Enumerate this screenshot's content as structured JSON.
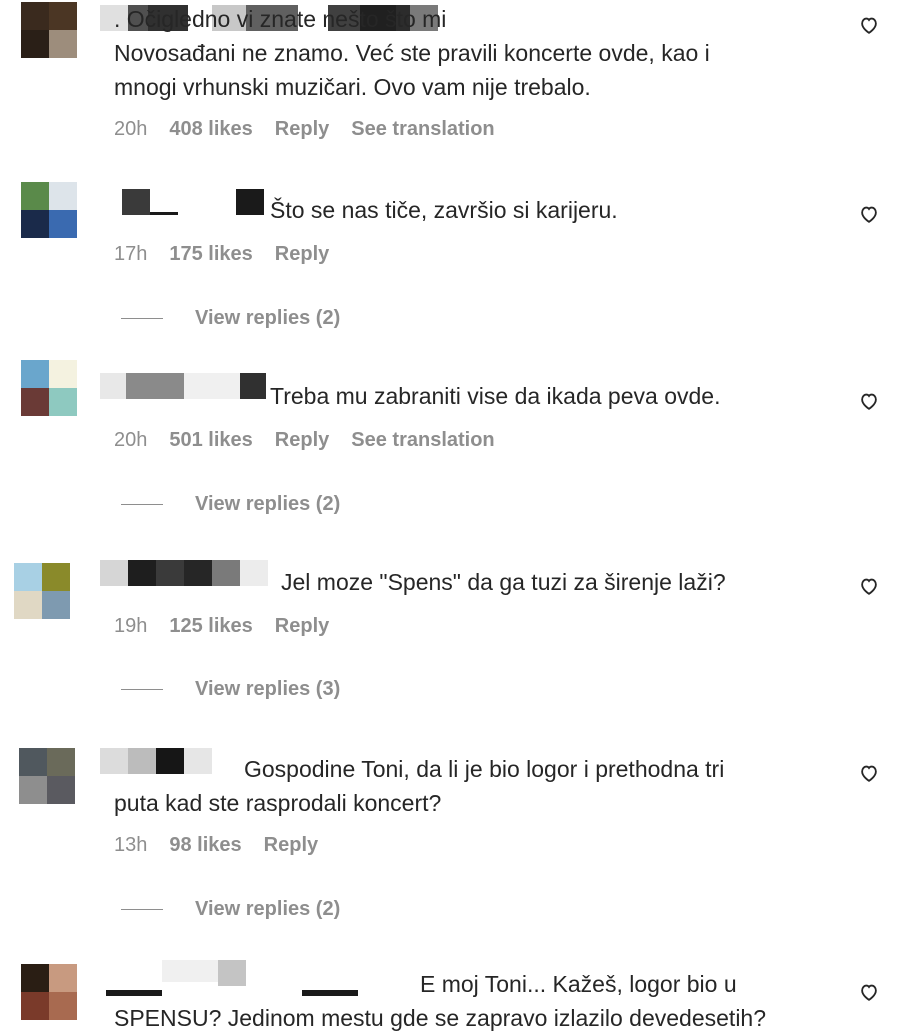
{
  "comments": [
    {
      "text": ". Očigledno vi znate nešto što mi\nNovosađani ne znamo. Već ste pravili koncerte ovde, kao i\nmnogi vrhunski muzičari. Ovo vam nije trebalo.",
      "time": "20h",
      "likes": "408 likes",
      "reply": "Reply",
      "translation": "See translation",
      "avatar_colors": [
        "#3a2a1e",
        "#4b3624",
        "#2a1f17",
        "#9d8d7c"
      ],
      "name_colors": [
        "#e0e0e0",
        "#505050",
        "#303030",
        "#ffffff",
        "#c8c8c8",
        "#606060",
        "#ffffff",
        "#404040",
        "#202020",
        "#2c2c2c",
        "#7a7a7a"
      ]
    },
    {
      "text": "Što se nas tiče, završio si karijeru.",
      "time": "17h",
      "likes": "175 likes",
      "reply": "Reply",
      "view_replies": "View replies (2)",
      "avatar_colors": [
        "#5a8a4a",
        "#dde4ea",
        "#1a2a4a",
        "#3a6ab0"
      ],
      "name_colors": [
        "#3a3a3a",
        "#ffffff",
        "#ffffff",
        "#1a1a1a"
      ]
    },
    {
      "text": "Treba mu zabraniti vise da ikada peva ovde.",
      "time": "20h",
      "likes": "501 likes",
      "reply": "Reply",
      "translation": "See translation",
      "view_replies": "View replies (2)",
      "avatar_colors": [
        "#6aa6cc",
        "#f4f2e0",
        "#6a3a36",
        "#8ec9c0"
      ],
      "name_colors": [
        "#e8e8e8",
        "#8a8a8a",
        "#f0f0f0",
        "#303030"
      ]
    },
    {
      "text": "Jel moze \"Spens\" da ga tuzi za širenje laži?",
      "time": "19h",
      "likes": "125 likes",
      "reply": "Reply",
      "view_replies": "View replies (3)",
      "avatar_colors": [
        "#a8d0e4",
        "#8a8a2a",
        "#e0d8c4",
        "#7e9ab0"
      ],
      "name_colors": [
        "#d6d6d6",
        "#1e1e1e",
        "#3a3a3a",
        "#262626",
        "#7a7a7a",
        "#ececec"
      ]
    },
    {
      "text": "Gospodine Toni, da li je bio logor i prethodna tri\nputa kad ste rasprodali koncert?",
      "time": "13h",
      "likes": "98 likes",
      "reply": "Reply",
      "view_replies": "View replies (2)",
      "avatar_colors": [
        "#50585e",
        "#6a6a5a",
        "#8e8e8e",
        "#5a5a60"
      ],
      "name_colors": [
        "#dcdcdc",
        "#bcbcbc",
        "#161616",
        "#e6e6e6"
      ]
    },
    {
      "text": "E moj Toni... Kažeš, logor bio u\nSPENSU? Jedinom mestu gde se zapravo izlazilo devedesetih?",
      "avatar_colors": [
        "#2a1e14",
        "#c89a80",
        "#7a3a2a",
        "#a86a50"
      ],
      "name_colors": [
        "#1a1a1a",
        "#f0f0f0",
        "#c4c4c4",
        "#f4f4f4",
        "#1a1a1a"
      ]
    }
  ],
  "icons": {
    "heart": "heart-outline-icon"
  }
}
